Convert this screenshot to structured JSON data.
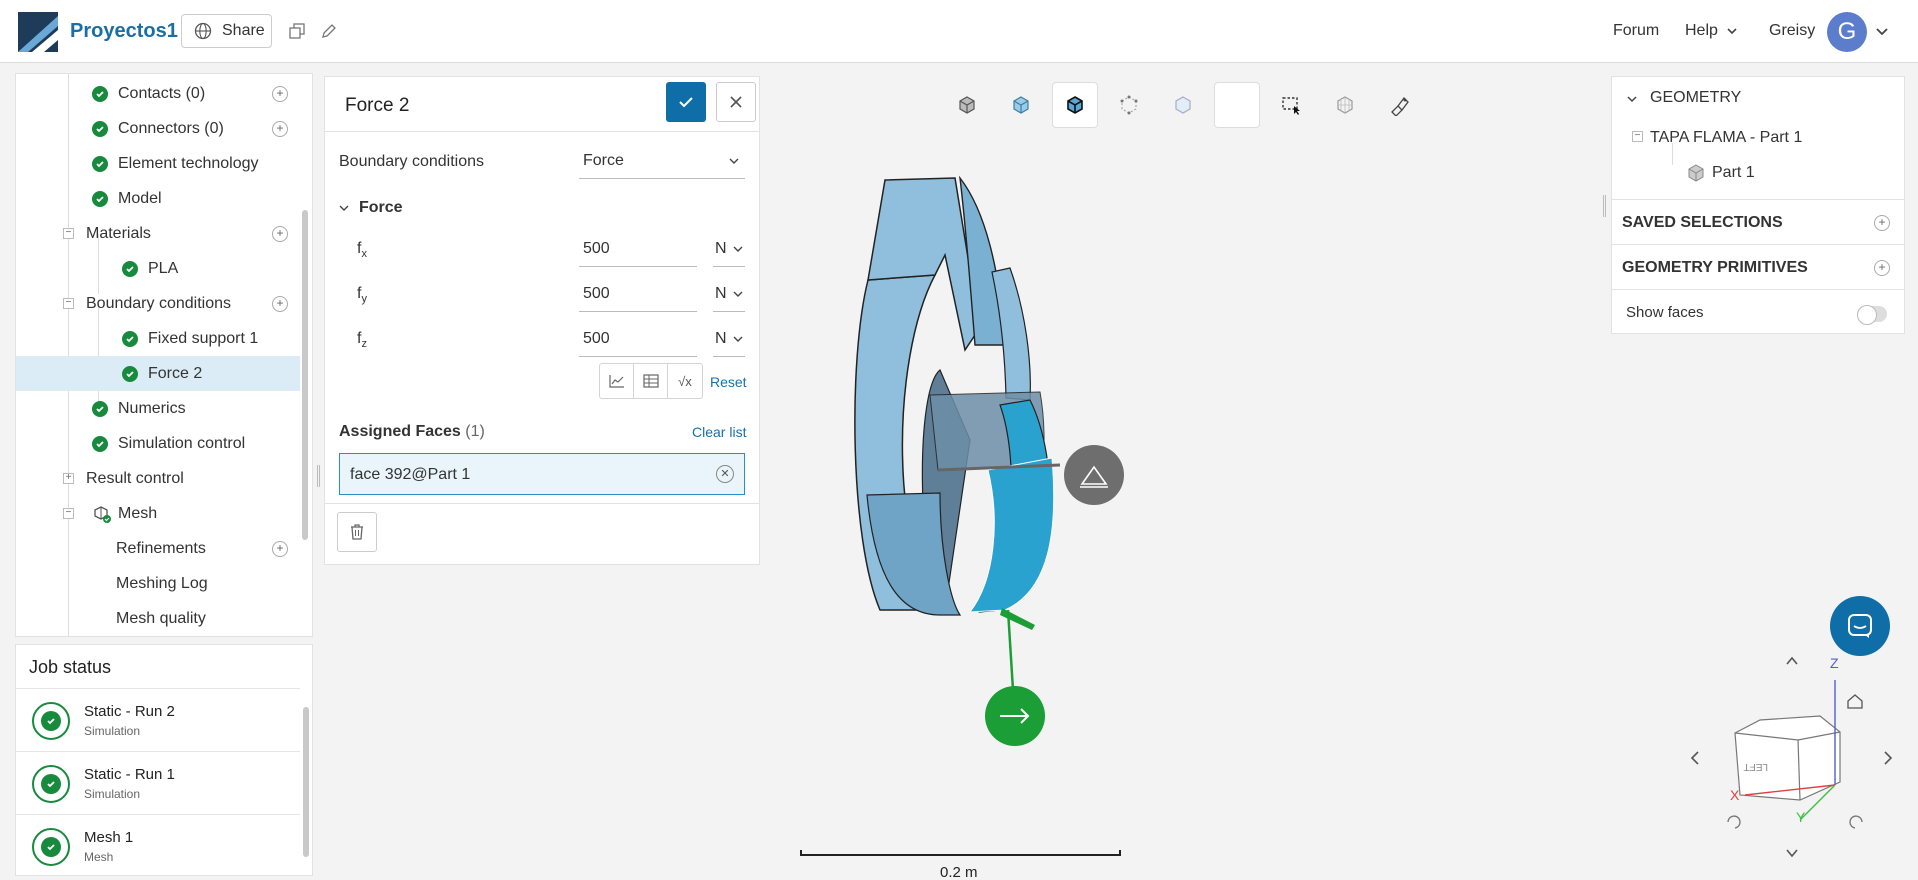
{
  "header": {
    "project_name": "Proyectos1",
    "share_label": "Share",
    "forum_label": "Forum",
    "help_label": "Help",
    "user_name": "Greisy",
    "avatar_initial": "G",
    "accent_color": "#1a6ea3"
  },
  "tree": {
    "items": [
      {
        "label": "Contacts (0)",
        "status": "check",
        "addable": true
      },
      {
        "label": "Connectors (0)",
        "status": "check",
        "addable": true
      },
      {
        "label": "Element technology",
        "status": "check"
      },
      {
        "label": "Model",
        "status": "check"
      },
      {
        "label": "Materials",
        "collapsible": true,
        "addable": true
      },
      {
        "label": "PLA",
        "status": "check"
      },
      {
        "label": "Boundary conditions",
        "collapsible": true,
        "addable": true
      },
      {
        "label": "Fixed support 1",
        "status": "check"
      },
      {
        "label": "Force 2",
        "status": "check",
        "selected": true
      },
      {
        "label": "Numerics",
        "status": "check"
      },
      {
        "label": "Simulation control",
        "status": "check"
      },
      {
        "label": "Result control",
        "collapsible": true
      },
      {
        "label": "Mesh",
        "collapsible": true,
        "icon": "mesh-icon"
      },
      {
        "label": "Refinements",
        "addable": true
      },
      {
        "label": "Meshing Log"
      },
      {
        "label": "Mesh quality"
      }
    ]
  },
  "job_status": {
    "title": "Job status",
    "jobs": [
      {
        "name": "Static - Run 2",
        "type": "Simulation"
      },
      {
        "name": "Static - Run 1",
        "type": "Simulation"
      },
      {
        "name": "Mesh 1",
        "type": "Mesh"
      }
    ]
  },
  "force_dialog": {
    "title": "Force 2",
    "bc_label": "Boundary conditions",
    "bc_value": "Force",
    "section_label": "Force",
    "components": [
      {
        "name": "f",
        "sub": "x",
        "value": "500",
        "unit": "N"
      },
      {
        "name": "f",
        "sub": "y",
        "value": "500",
        "unit": "N"
      },
      {
        "name": "f",
        "sub": "z",
        "value": "500",
        "unit": "N"
      }
    ],
    "reset_label": "Reset",
    "sqrt_label": "√x",
    "assigned_label": "Assigned Faces",
    "assigned_count": "(1)",
    "clear_label": "Clear list",
    "assigned_face": "face 392@Part 1"
  },
  "geometry_panel": {
    "geometry_title": "GEOMETRY",
    "part_name": "TAPA FLAMA - Part 1",
    "subpart": "Part 1",
    "saved_selections": "SAVED SELECTIONS",
    "geometry_primitives": "GEOMETRY PRIMITIVES",
    "show_faces": "Show faces"
  },
  "viewport": {
    "scale_label": "0.2 m",
    "cube_face_label": "LEFT",
    "axis_x": "X",
    "axis_y": "Y",
    "axis_z": "Z",
    "axis_colors": {
      "x": "#e04040",
      "y": "#40c040",
      "z": "#5060d0"
    }
  }
}
